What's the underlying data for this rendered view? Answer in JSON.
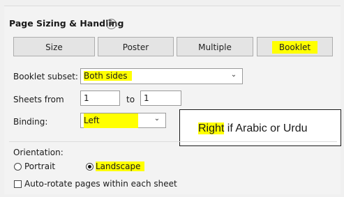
{
  "section": {
    "title": "Page Sizing & Handling",
    "info_icon": "info-icon"
  },
  "mode_buttons": [
    {
      "label": "Size"
    },
    {
      "label": "Poster"
    },
    {
      "label": "Multiple"
    },
    {
      "label": "Booklet",
      "selected": true
    }
  ],
  "booklet_subset": {
    "label": "Booklet subset:",
    "value": "Both sides"
  },
  "sheets": {
    "label": "Sheets from",
    "from_value": "1",
    "to_label": "to",
    "to_value": "1"
  },
  "binding": {
    "label": "Binding:",
    "value": "Left"
  },
  "note": {
    "highlight": "Right",
    "text": " if Arabic or Urdu"
  },
  "orientation": {
    "label": "Orientation:",
    "portrait_label": "Portrait",
    "landscape_label": "Landscape",
    "selected": "Landscape"
  },
  "auto_rotate": {
    "label": "Auto-rotate pages within each sheet",
    "checked": false
  },
  "colors": {
    "highlight": "#ffff00",
    "panel_bg": "#f3f3f3",
    "button_bg": "#e4e4e4"
  }
}
